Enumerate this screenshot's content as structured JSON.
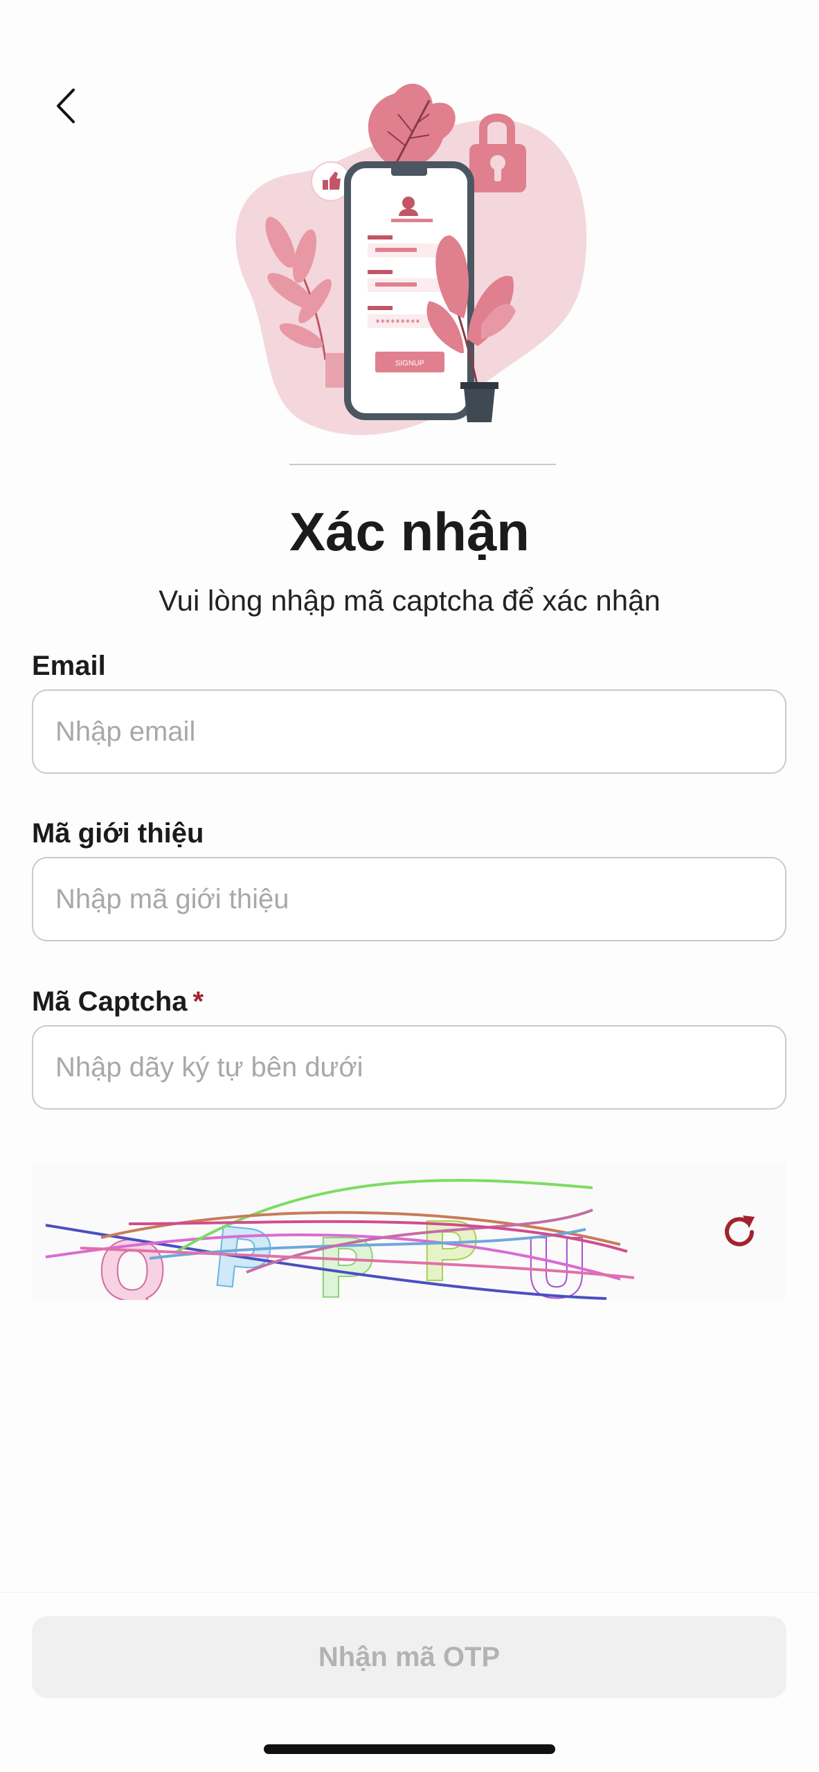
{
  "icons": {
    "back": "chevron-left-icon",
    "refresh": "refresh-icon"
  },
  "header": {
    "title": "Xác nhận",
    "subtitle": "Vui lòng nhập mã captcha để xác nhận"
  },
  "form": {
    "email": {
      "label": "Email",
      "placeholder": "Nhập email",
      "value": ""
    },
    "referral": {
      "label": "Mã giới thiệu",
      "placeholder": "Nhập mã giới thiệu",
      "value": ""
    },
    "captcha": {
      "label": "Mã Captcha",
      "required_mark": "*",
      "placeholder": "Nhập dãy ký tự bên dưới",
      "value": ""
    }
  },
  "captcha_image": {
    "characters": [
      "Q",
      "P",
      "P",
      "P",
      "U"
    ]
  },
  "illustration": {
    "button_text": "SIGNUP"
  },
  "footer": {
    "submit_label": "Nhận mã OTP"
  },
  "colors": {
    "accent": "#a3232d",
    "illustration_pink": "#e07f8e",
    "disabled_button_bg": "#f0f0f0",
    "disabled_button_text": "#b3b3b3"
  }
}
